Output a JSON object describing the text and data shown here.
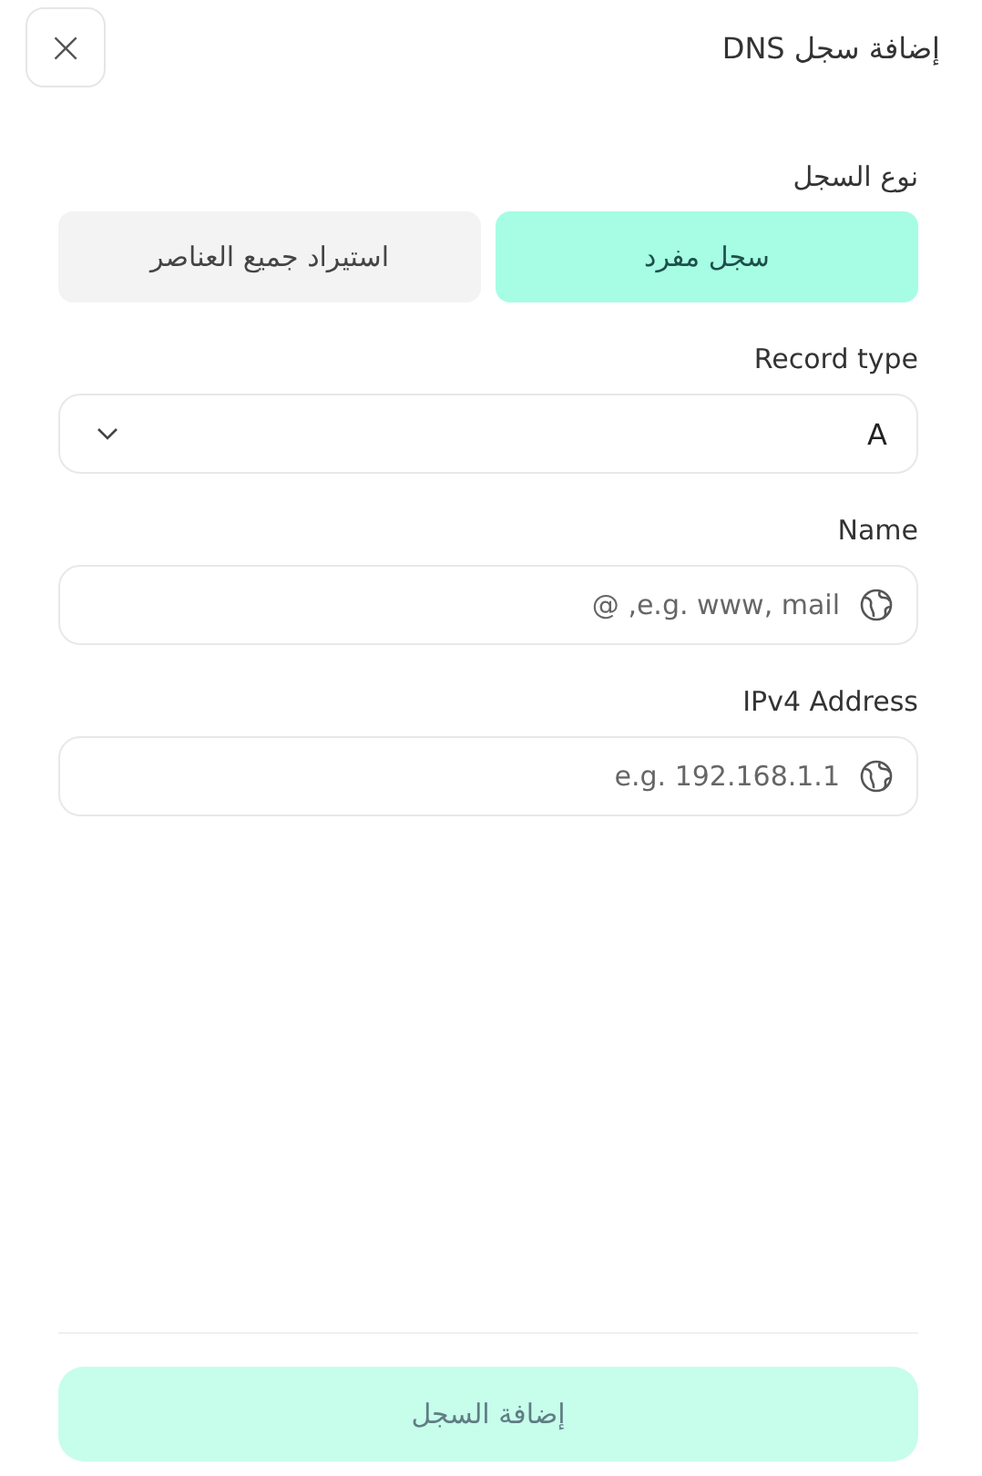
{
  "dialog": {
    "title": "إضافة سجل DNS",
    "close": "×"
  },
  "record_mode": {
    "label": "نوع السجل",
    "tabs": [
      {
        "label": "سجل مفرد",
        "selected": true
      },
      {
        "label": "استيراد جميع العناصر",
        "selected": false
      }
    ]
  },
  "record_type": {
    "label": "Record type",
    "value": "A"
  },
  "fields": [
    {
      "label": "Name",
      "placeholder": "@ ,e.g. www, mail"
    },
    {
      "label": "IPv4 Address",
      "placeholder": "e.g. 192.168.1.1"
    }
  ],
  "submit": {
    "label": "إضافة السجل",
    "disabled": true
  }
}
